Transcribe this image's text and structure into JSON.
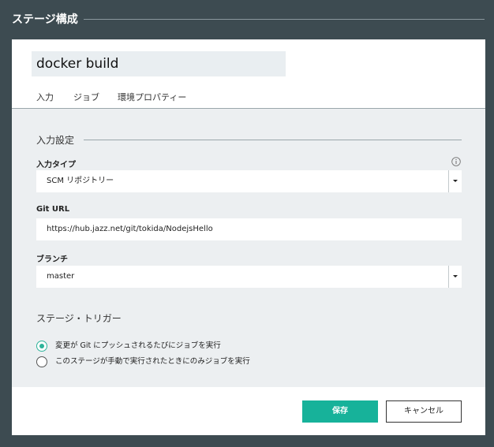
{
  "header": {
    "title": "ステージ構成"
  },
  "stage": {
    "name": "docker build"
  },
  "tabs": [
    {
      "label": "入力"
    },
    {
      "label": "ジョブ"
    },
    {
      "label": "環境プロパティー"
    }
  ],
  "input_settings": {
    "section_title": "入力設定",
    "input_type": {
      "label": "入力タイプ",
      "value": "SCM リポジトリー"
    },
    "git_url": {
      "label": "Git URL",
      "value": "https://hub.jazz.net/git/tokida/NodejsHello"
    },
    "branch": {
      "label": "ブランチ",
      "value": "master"
    }
  },
  "trigger": {
    "title": "ステージ・トリガー",
    "options": [
      {
        "label": "変更が Git にプッシュされるたびにジョブを実行",
        "checked": true
      },
      {
        "label": "このステージが手動で実行されたときにのみジョブを実行",
        "checked": false
      }
    ]
  },
  "buttons": {
    "save": "保存",
    "cancel": "キャンセル"
  },
  "colors": {
    "accent": "#17b29a",
    "frame": "#3d4b51",
    "panel": "#eceff1"
  }
}
